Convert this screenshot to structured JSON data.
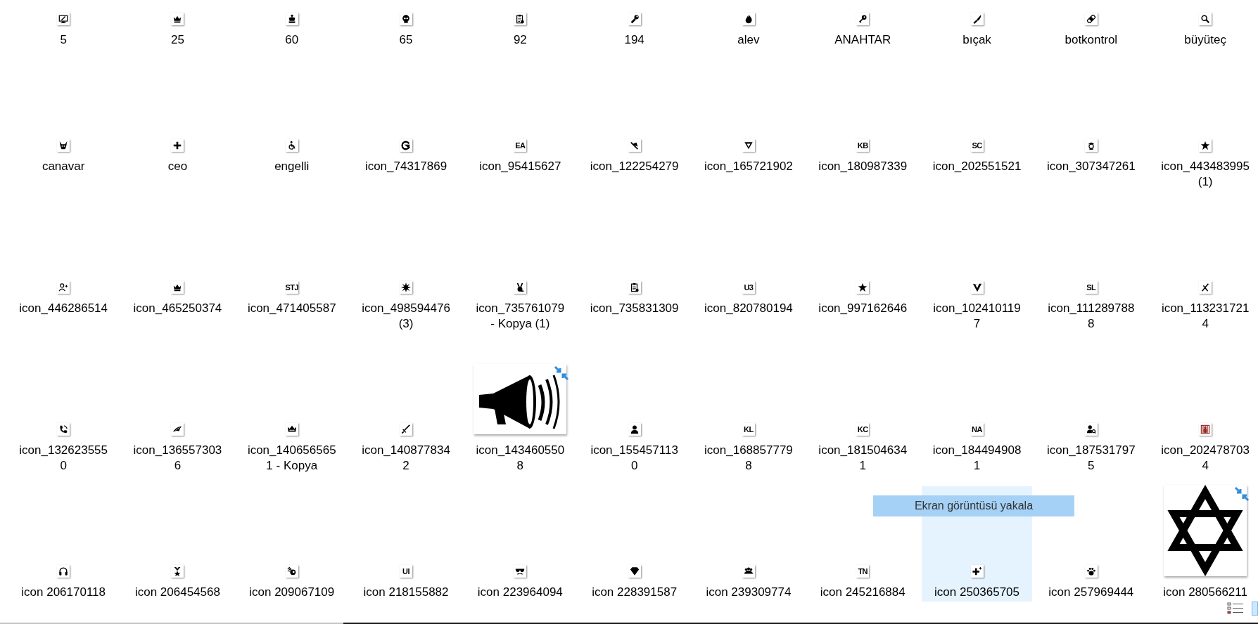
{
  "files": [
    {
      "kind": "glyph",
      "lines": [
        "5"
      ],
      "hovered": false
    },
    {
      "kind": "glyph",
      "lines": [
        "25"
      ],
      "hovered": false
    },
    {
      "kind": "glyph",
      "lines": [
        "60"
      ],
      "hovered": false
    },
    {
      "kind": "glyph",
      "lines": [
        "65"
      ],
      "hovered": false
    },
    {
      "kind": "glyph",
      "lines": [
        "92"
      ],
      "hovered": false
    },
    {
      "kind": "glyph",
      "lines": [
        "194"
      ],
      "hovered": false
    },
    {
      "kind": "glyph",
      "lines": [
        "alev"
      ],
      "hovered": false
    },
    {
      "kind": "glyph",
      "lines": [
        "ANAHTAR"
      ],
      "hovered": false
    },
    {
      "kind": "glyph",
      "lines": [
        "bıçak"
      ],
      "hovered": false
    },
    {
      "kind": "glyph",
      "lines": [
        "botkontrol"
      ],
      "hovered": false
    },
    {
      "kind": "glyph",
      "lines": [
        "büyüteç"
      ],
      "hovered": false
    },
    {
      "kind": "glyph",
      "lines": [
        "canavar"
      ],
      "hovered": false
    },
    {
      "kind": "glyph",
      "lines": [
        "ceo"
      ],
      "hovered": false
    },
    {
      "kind": "glyph",
      "lines": [
        "engelli"
      ],
      "hovered": false
    },
    {
      "kind": "glyph",
      "lines": [
        "icon_74317869"
      ],
      "hovered": false
    },
    {
      "kind": "letters",
      "icon_text": "EA",
      "lines": [
        "icon_95415627"
      ],
      "hovered": false
    },
    {
      "kind": "glyph",
      "lines": [
        "icon_122254279"
      ],
      "hovered": false
    },
    {
      "kind": "glyph",
      "lines": [
        "icon_165721902"
      ],
      "hovered": false
    },
    {
      "kind": "letters",
      "icon_text": "KB",
      "lines": [
        "icon_180987339"
      ],
      "hovered": false
    },
    {
      "kind": "letters",
      "icon_text": "SC",
      "lines": [
        "icon_202551521"
      ],
      "hovered": false
    },
    {
      "kind": "glyph",
      "lines": [
        "icon_307347261"
      ],
      "hovered": false
    },
    {
      "kind": "glyph",
      "lines": [
        "icon_443483995",
        "(1)"
      ],
      "hovered": false
    },
    {
      "kind": "glyph",
      "lines": [
        "icon_446286514"
      ],
      "hovered": false
    },
    {
      "kind": "glyph",
      "lines": [
        "icon_465250374"
      ],
      "hovered": false
    },
    {
      "kind": "letters",
      "icon_text": "STJ",
      "lines": [
        "icon_471405587"
      ],
      "hovered": false
    },
    {
      "kind": "glyph",
      "lines": [
        "icon_498594476",
        "(3)"
      ],
      "hovered": false
    },
    {
      "kind": "glyph",
      "lines": [
        "icon_735761079",
        "- Kopya (1)"
      ],
      "hovered": false
    },
    {
      "kind": "glyph",
      "lines": [
        "icon_735831309"
      ],
      "hovered": false
    },
    {
      "kind": "letters",
      "icon_text": "U3",
      "lines": [
        "icon_820780194"
      ],
      "hovered": false
    },
    {
      "kind": "glyph",
      "lines": [
        "icon_997162646"
      ],
      "hovered": false
    },
    {
      "kind": "glyph",
      "lines": [
        "icon_102410119",
        "7"
      ],
      "hovered": false
    },
    {
      "kind": "letters",
      "icon_text": "SL",
      "lines": [
        "icon_111289788",
        "8"
      ],
      "hovered": false
    },
    {
      "kind": "glyph",
      "lines": [
        "icon_113231721",
        "4"
      ],
      "hovered": false
    },
    {
      "kind": "glyph",
      "lines": [
        "icon_132623555",
        "0"
      ],
      "hovered": false
    },
    {
      "kind": "glyph",
      "lines": [
        "icon_136557303",
        "6"
      ],
      "hovered": false
    },
    {
      "kind": "glyph",
      "lines": [
        "icon_140656565",
        "1 - Kopya"
      ],
      "hovered": false
    },
    {
      "kind": "glyph",
      "lines": [
        "icon_140877834",
        "2"
      ],
      "hovered": false
    },
    {
      "kind": "thumbnail",
      "lines": [
        "icon_143460550",
        "8"
      ],
      "hovered": false
    },
    {
      "kind": "glyph",
      "lines": [
        "icon_155457113",
        "0"
      ],
      "hovered": false
    },
    {
      "kind": "letters",
      "icon_text": "KL",
      "lines": [
        "icon_168857779",
        "8"
      ],
      "hovered": false
    },
    {
      "kind": "letters",
      "icon_text": "KC",
      "lines": [
        "icon_181504634",
        "1"
      ],
      "hovered": false
    },
    {
      "kind": "letters",
      "icon_text": "NA",
      "lines": [
        "icon_184494908",
        "1"
      ],
      "hovered": false
    },
    {
      "kind": "glyph",
      "lines": [
        "icon_187531797",
        "5"
      ],
      "hovered": false
    },
    {
      "kind": "glyph",
      "lines": [
        "icon_202478703",
        "4"
      ],
      "hovered": false
    },
    {
      "kind": "glyph",
      "lines": [
        "icon 206170118"
      ],
      "hovered": false
    },
    {
      "kind": "glyph",
      "lines": [
        "icon 206454568"
      ],
      "hovered": false
    },
    {
      "kind": "glyph",
      "lines": [
        "icon 209067109"
      ],
      "hovered": false
    },
    {
      "kind": "letters",
      "icon_text": "UI",
      "lines": [
        "icon 218155882"
      ],
      "hovered": false
    },
    {
      "kind": "glyph",
      "lines": [
        "icon 223964094"
      ],
      "hovered": false
    },
    {
      "kind": "glyph",
      "lines": [
        "icon 228391587"
      ],
      "hovered": false
    },
    {
      "kind": "glyph",
      "lines": [
        "icon 239309774"
      ],
      "hovered": false
    },
    {
      "kind": "letters",
      "icon_text": "TN",
      "lines": [
        "icon 245216884"
      ],
      "hovered": false
    },
    {
      "kind": "glyph",
      "lines": [
        "icon 250365705"
      ],
      "hovered": true
    },
    {
      "kind": "glyph",
      "lines": [
        "icon 257969444"
      ],
      "hovered": false
    },
    {
      "kind": "thumbnail",
      "lines": [
        "icon 280566211"
      ],
      "hovered": false
    }
  ],
  "tooltip": {
    "text": "Ekran görüntüsü yakala"
  }
}
